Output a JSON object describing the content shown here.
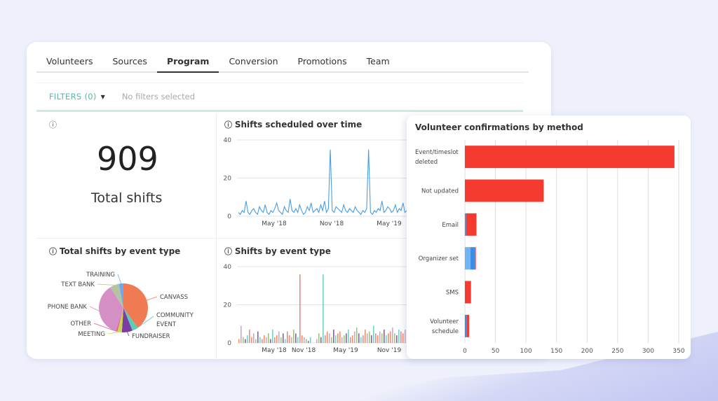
{
  "tabs": [
    {
      "label": "Volunteers"
    },
    {
      "label": "Sources"
    },
    {
      "label": "Program",
      "active": true
    },
    {
      "label": "Conversion"
    },
    {
      "label": "Promotions"
    },
    {
      "label": "Team"
    }
  ],
  "filters": {
    "label": "FILTERS (0)",
    "status": "No filters selected"
  },
  "kpi": {
    "value": "909",
    "label": "Total shifts",
    "info_icon": "info-icon"
  },
  "colors": {
    "accent": "#5bb5a8",
    "line": "#4a9ee0",
    "bar_red": "#f53b30",
    "bar_blue": "#3a8ee8",
    "bar_lightblue": "#6fb4f5"
  },
  "chart_data": [
    {
      "type": "line",
      "title": "Shifts scheduled over time",
      "y_ticks": [
        "0",
        "20",
        "40"
      ],
      "ylim": [
        0,
        40
      ],
      "x_ticks": [
        "May '18",
        "Nov '18",
        "May '19"
      ],
      "values": [
        2,
        1,
        3,
        2,
        8,
        2,
        1,
        3,
        4,
        2,
        1,
        5,
        3,
        2,
        6,
        2,
        1,
        3,
        2,
        4,
        7,
        3,
        2,
        1,
        5,
        3,
        2,
        9,
        3,
        2,
        4,
        2,
        6,
        3,
        1,
        2,
        5,
        3,
        7,
        2,
        3,
        4,
        2,
        6,
        3,
        8,
        2,
        4,
        35,
        3,
        2,
        5,
        4,
        3,
        2,
        6,
        3,
        2,
        4,
        3,
        2,
        5,
        3,
        2,
        1,
        3,
        2,
        4,
        35,
        2,
        1,
        3,
        2,
        4,
        3,
        8,
        2,
        3,
        5,
        4,
        2,
        3,
        6,
        2,
        4,
        3,
        7,
        2,
        3,
        5
      ]
    },
    {
      "type": "pie",
      "title": "Total shifts by event type",
      "slices": [
        {
          "label": "CANVASS",
          "value": 40,
          "color": "#f07b52"
        },
        {
          "label": "COMMUNITY EVENT",
          "value": 4,
          "color": "#5ccbb8"
        },
        {
          "label": "FUNDRAISER",
          "value": 7,
          "color": "#7a3ea3"
        },
        {
          "label": "MEETING",
          "value": 3,
          "color": "#c9d64a"
        },
        {
          "label": "OTHER",
          "value": 1,
          "color": "#e25b9a"
        },
        {
          "label": "PHONE BANK",
          "value": 36,
          "color": "#d48fc4"
        },
        {
          "label": "TEXT BANK",
          "value": 6,
          "color": "#b5c4a0"
        },
        {
          "label": "TRAINING",
          "value": 3,
          "color": "#6aaaf0"
        }
      ]
    },
    {
      "type": "bar",
      "title": "Shifts by event type",
      "y_ticks": [
        "0",
        "20",
        "40"
      ],
      "ylim": [
        0,
        40
      ],
      "x_ticks": [
        "May '18",
        "Nov '18",
        "May '19",
        "Nov '19"
      ],
      "series_colors": [
        "#f07b52",
        "#d48fc4",
        "#8fb86c",
        "#7a3ea3",
        "#5ccbb8",
        "#e8756a"
      ],
      "values": [
        2,
        9,
        3,
        2,
        4,
        7,
        3,
        5,
        2,
        6,
        3,
        2,
        4,
        3,
        5,
        2,
        7,
        3,
        4,
        6,
        3,
        5,
        2,
        6,
        4,
        3,
        7,
        5,
        3,
        36,
        4,
        3,
        2,
        1,
        3,
        0,
        0,
        2,
        5,
        3,
        36,
        4,
        6,
        5,
        3,
        7,
        4,
        5,
        6,
        3,
        4,
        5,
        7,
        3,
        4,
        6,
        8,
        5,
        3,
        4,
        7,
        5,
        6,
        4,
        9,
        5,
        4,
        6,
        5,
        7,
        4,
        5,
        6,
        8,
        5,
        4,
        7,
        6,
        5,
        7
      ]
    },
    {
      "type": "bar",
      "orientation": "horizontal",
      "stacked": true,
      "title": "Volunteer confirmations by method",
      "xlim": [
        0,
        350
      ],
      "x_ticks": [
        "0",
        "50",
        "100",
        "150",
        "200",
        "250",
        "300",
        "350"
      ],
      "categories": [
        "Event/timeslot deleted",
        "Not updated",
        "Email",
        "Organizer set",
        "SMS",
        "Volunteer schedule"
      ],
      "series": [
        {
          "color": "#6fb4f5",
          "values": [
            0,
            0,
            0,
            9,
            0,
            0
          ]
        },
        {
          "color": "#3a8ee8",
          "values": [
            0,
            0,
            2,
            8,
            0,
            3
          ]
        },
        {
          "color": "#f53b30",
          "values": [
            343,
            129,
            17,
            1,
            10,
            4
          ]
        }
      ]
    }
  ]
}
